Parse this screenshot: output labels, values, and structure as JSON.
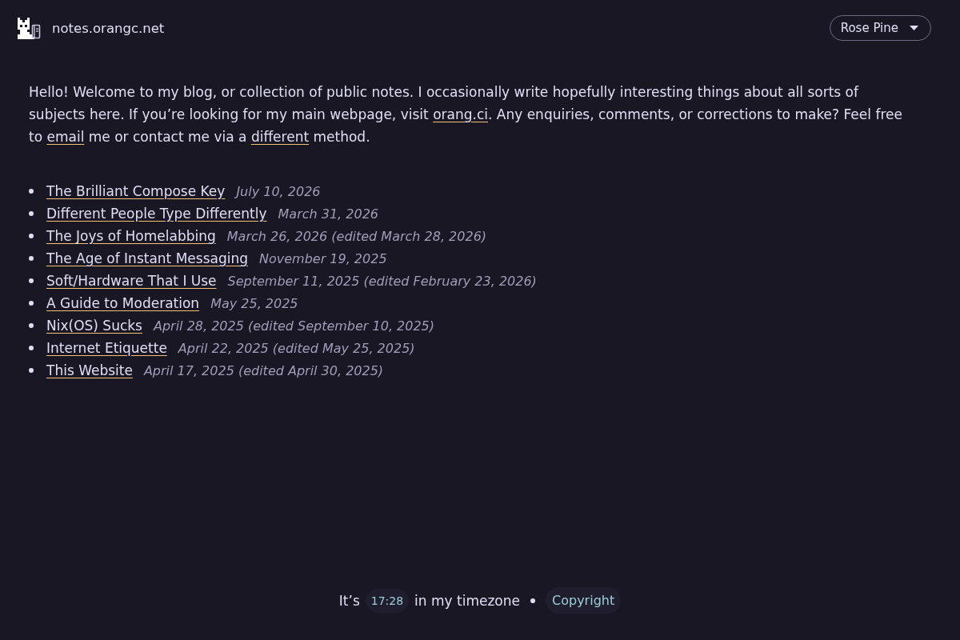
{
  "header": {
    "site_title": "notes.orangc.net",
    "theme_select": {
      "value": "Rose Pine"
    }
  },
  "intro": [
    {
      "kind": "text",
      "text": "Hello! Welcome to my blog, or collection of public notes. I occasionally write hopefully interesting things about all sorts of subjects here. If you’re looking for my main webpage, visit "
    },
    {
      "kind": "link",
      "text": "orang.ci"
    },
    {
      "kind": "text",
      "text": ". Any enquiries, comments, or corrections to make? Feel free to "
    },
    {
      "kind": "link",
      "text": "email"
    },
    {
      "kind": "text",
      "text": " me or contact me via a "
    },
    {
      "kind": "link",
      "text": "different"
    },
    {
      "kind": "text",
      "text": " method."
    }
  ],
  "posts": [
    {
      "title": "The Brilliant Compose Key",
      "date": "July 10, 2026"
    },
    {
      "title": "Different People Type Differently",
      "date": "March 31, 2026"
    },
    {
      "title": "The Joys of Homelabbing",
      "date": "March 26, 2026 (edited March 28, 2026)"
    },
    {
      "title": "The Age of Instant Messaging",
      "date": "November 19, 2025"
    },
    {
      "title": "Soft/Hardware That I Use",
      "date": "September 11, 2025 (edited February 23, 2026)"
    },
    {
      "title": "A Guide to Moderation",
      "date": "May 25, 2025"
    },
    {
      "title": "Nix(OS) Sucks",
      "date": "April 28, 2025 (edited September 10, 2025)"
    },
    {
      "title": "Internet Etiquette",
      "date": "April 22, 2025 (edited May 25, 2025)"
    },
    {
      "title": "This Website",
      "date": "April 17, 2025 (edited April 30, 2025)"
    }
  ],
  "footer": {
    "prefix": "It’s",
    "time": "17:28",
    "suffix": "in my timezone",
    "copyright": "Copyright"
  }
}
